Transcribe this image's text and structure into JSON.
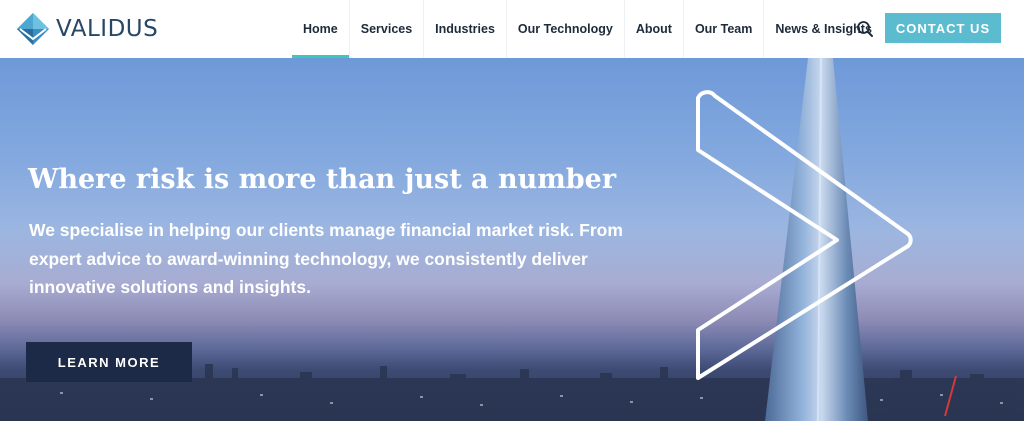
{
  "brand": {
    "name": "VALIDUS",
    "logo_icon": "diamond-logo-icon",
    "accent": "#3fc7bd"
  },
  "nav": {
    "items": [
      {
        "label": "Home",
        "active": true
      },
      {
        "label": "Services",
        "active": false
      },
      {
        "label": "Industries",
        "active": false
      },
      {
        "label": "Our Technology",
        "active": false
      },
      {
        "label": "About",
        "active": false
      },
      {
        "label": "Our Team",
        "active": false
      },
      {
        "label": "News & Insights",
        "active": false
      }
    ],
    "search_icon": "search-icon",
    "contact_label": "CONTACT US",
    "contact_color": "#5bbcd0"
  },
  "hero": {
    "headline": "Where risk is more than just a number",
    "subtext": "We specialise in helping our clients manage financial market risk. From expert advice to award-winning technology, we consistently deliver innovative solutions and insights.",
    "cta_label": "LEARN MORE",
    "cta_color": "#1c2a47"
  }
}
